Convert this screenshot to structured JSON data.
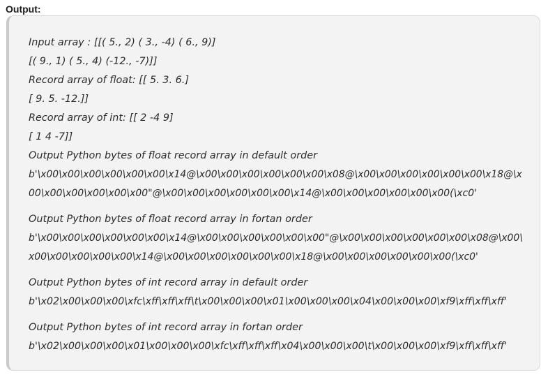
{
  "heading": "Output:",
  "output_lines": [
    "Input array : [[( 5., 2) ( 3., -4) ( 6., 9)]",
    "[( 9., 1) ( 5., 4) (-12., -7)]]",
    "Record array of float: [[ 5. 3. 6.]",
    "[ 9. 5. -12.]]",
    "Record array of int: [[ 2 -4 9]",
    "[ 1 4 -7]]",
    "Output Python bytes of float record array in default order",
    "b'\\x00\\x00\\x00\\x00\\x00\\x00\\x14@\\x00\\x00\\x00\\x00\\x00\\x00\\x08@\\x00\\x00\\x00\\x00\\x00\\x00\\x18@\\x",
    "00\\x00\\x00\\x00\\x00\\x00\"@\\x00\\x00\\x00\\x00\\x00\\x00\\x14@\\x00\\x00\\x00\\x00\\x00\\x00(\\xc0'",
    "Output Python bytes of float record array in fortan order",
    "b'\\x00\\x00\\x00\\x00\\x00\\x00\\x14@\\x00\\x00\\x00\\x00\\x00\\x00\"@\\x00\\x00\\x00\\x00\\x00\\x00\\x08@\\x00\\",
    "x00\\x00\\x00\\x00\\x00\\x14@\\x00\\x00\\x00\\x00\\x00\\x00\\x18@\\x00\\x00\\x00\\x00\\x00\\x00(\\xc0'",
    "Output Python bytes of int record array in default order",
    "b'\\x02\\x00\\x00\\x00\\xfc\\xff\\xff\\xff\\t\\x00\\x00\\x00\\x01\\x00\\x00\\x00\\x04\\x00\\x00\\x00\\xf9\\xff\\xff\\xff'",
    "Output Python bytes of int record array in fortan order",
    "b'\\x02\\x00\\x00\\x00\\x01\\x00\\x00\\x00\\xfc\\xff\\xff\\xff\\x04\\x00\\x00\\x00\\t\\x00\\x00\\x00\\xf9\\xff\\xff\\xff'"
  ]
}
